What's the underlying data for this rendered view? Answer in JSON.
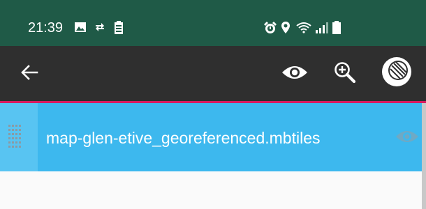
{
  "status_bar": {
    "time": "21:39",
    "left_icons": [
      "image-icon",
      "sync-arrows-icon",
      "battery-saver-icon"
    ],
    "right_icons": [
      "alarm-icon",
      "location-pin-icon",
      "wifi-icon",
      "signal-icon",
      "battery-icon"
    ]
  },
  "toolbar": {
    "icons": [
      "back-arrow-icon",
      "eye-icon",
      "zoom-in-icon",
      "layers-icon"
    ]
  },
  "layers": [
    {
      "name": "map-glen-etive_georeferenced.mbtiles",
      "visible": false
    }
  ],
  "colors": {
    "status_bar": "#1f5a47",
    "toolbar": "#2f2f2f",
    "accent_line": "#d81b60",
    "row_selected": "#3db8ee",
    "background": "#fafafa"
  }
}
